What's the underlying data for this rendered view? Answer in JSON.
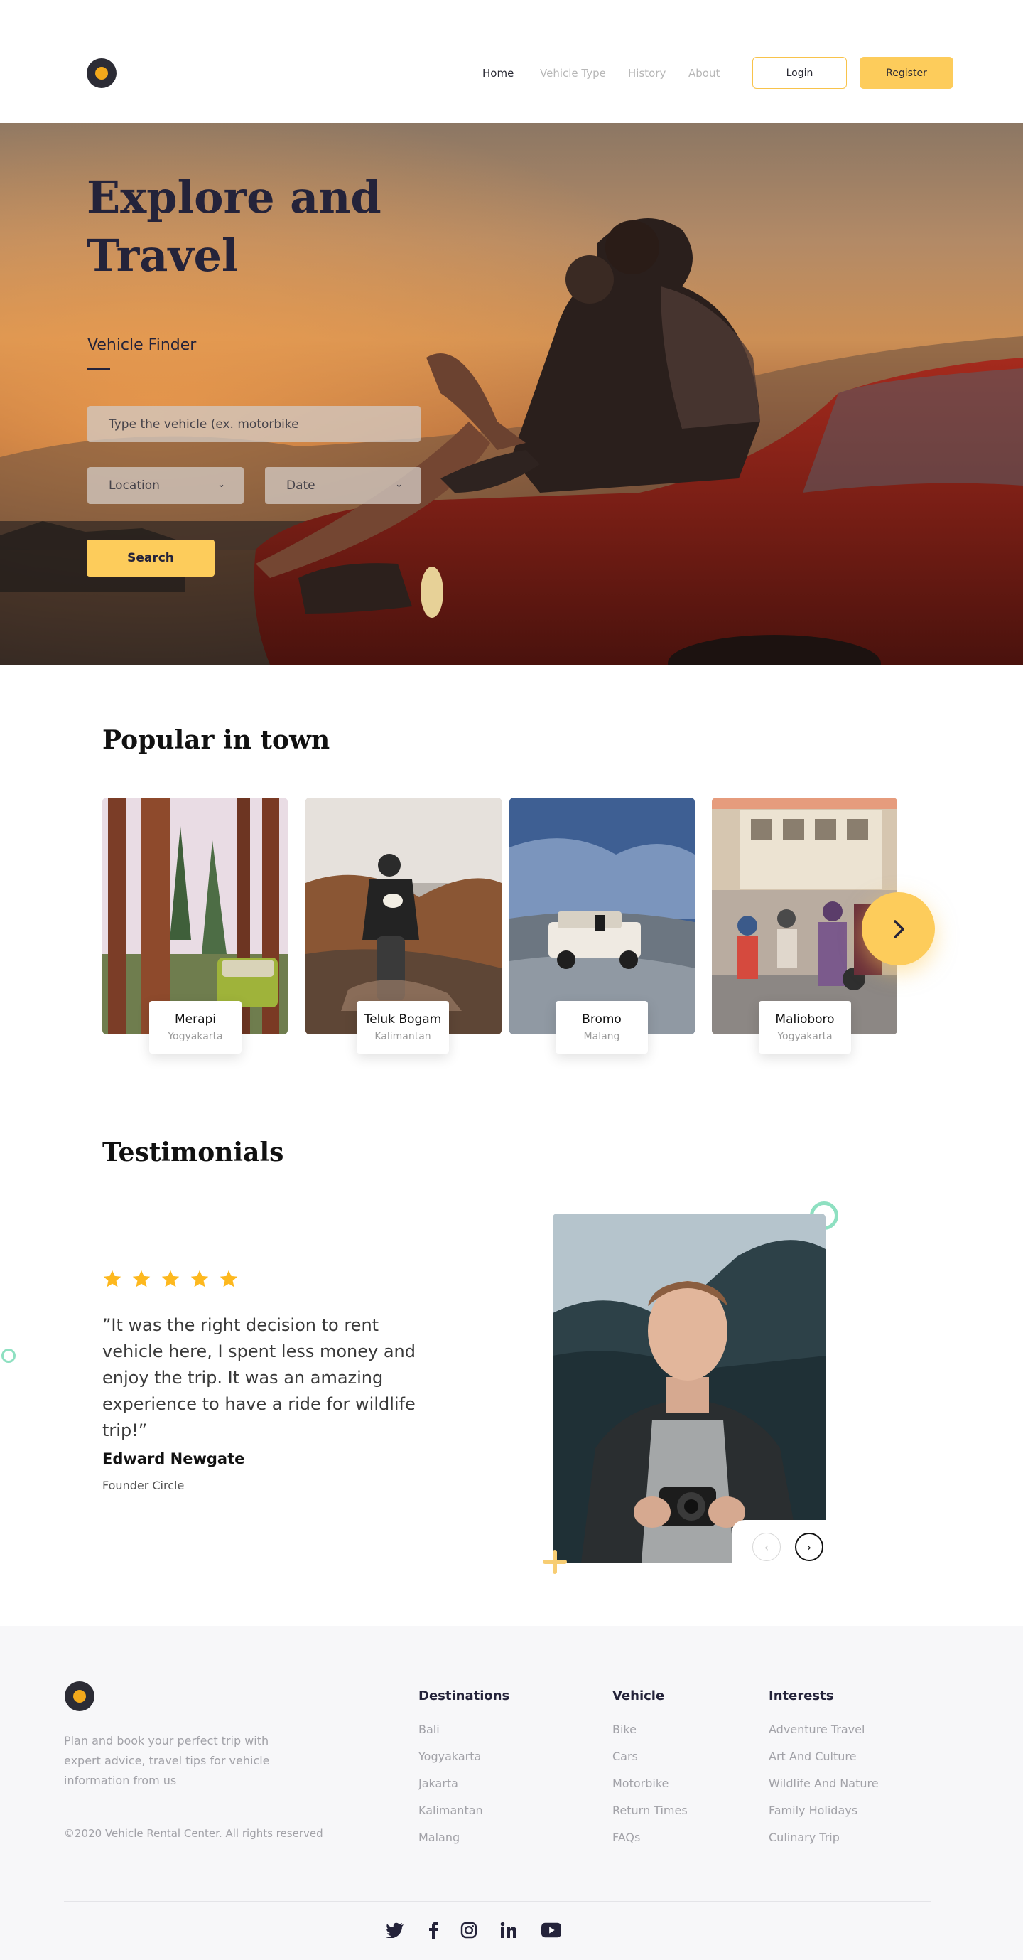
{
  "nav": {
    "links": [
      "Home",
      "Vehicle Type",
      "History",
      "About"
    ],
    "login_label": "Login",
    "register_label": "Register"
  },
  "hero": {
    "title": "Explore and Travel",
    "finder_label": "Vehicle Finder",
    "vehicle_placeholder": "Type the vehicle (ex. motorbike",
    "location_label": "Location",
    "date_label": "Date",
    "search_label": "Search"
  },
  "popular": {
    "title": "Popular in town",
    "items": [
      {
        "name": "Merapi",
        "city": "Yogyakarta"
      },
      {
        "name": "Teluk Bogam",
        "city": "Kalimantan"
      },
      {
        "name": "Bromo",
        "city": "Malang"
      },
      {
        "name": "Malioboro",
        "city": "Yogyakarta"
      }
    ]
  },
  "testimonials": {
    "title": "Testimonials",
    "rating": 5,
    "star_color": "#fdb81e",
    "quote": "”It was the right decision to rent vehicle here, I spent less money and enjoy the trip. It was an amazing experience to have a ride for wildlife trip!”",
    "name": "Edward Newgate",
    "role": "Founder Circle"
  },
  "footer": {
    "description": "Plan and book your perfect trip with expert advice, travel tips for vehicle information from us",
    "copyright": "©2020 Vehicle Rental Center. All rights reserved",
    "columns": [
      {
        "heading": "Destinations",
        "items": [
          "Bali",
          "Yogyakarta",
          "Jakarta",
          "Kalimantan",
          "Malang"
        ]
      },
      {
        "heading": "Vehicle",
        "items": [
          "Bike",
          "Cars",
          "Motorbike",
          "Return Times",
          "FAQs"
        ]
      },
      {
        "heading": "Interests",
        "items": [
          "Adventure Travel",
          "Art And Culture",
          "Wildlife And Nature",
          "Family Holidays",
          "Culinary Trip"
        ]
      }
    ],
    "social_icons": [
      "twitter-icon",
      "facebook-icon",
      "instagram-icon",
      "linkedin-icon",
      "youtube-icon"
    ]
  },
  "colors": {
    "accent": "#fdcc5b",
    "dark": "#24233a",
    "teal_ring": "#8ee0c1"
  }
}
